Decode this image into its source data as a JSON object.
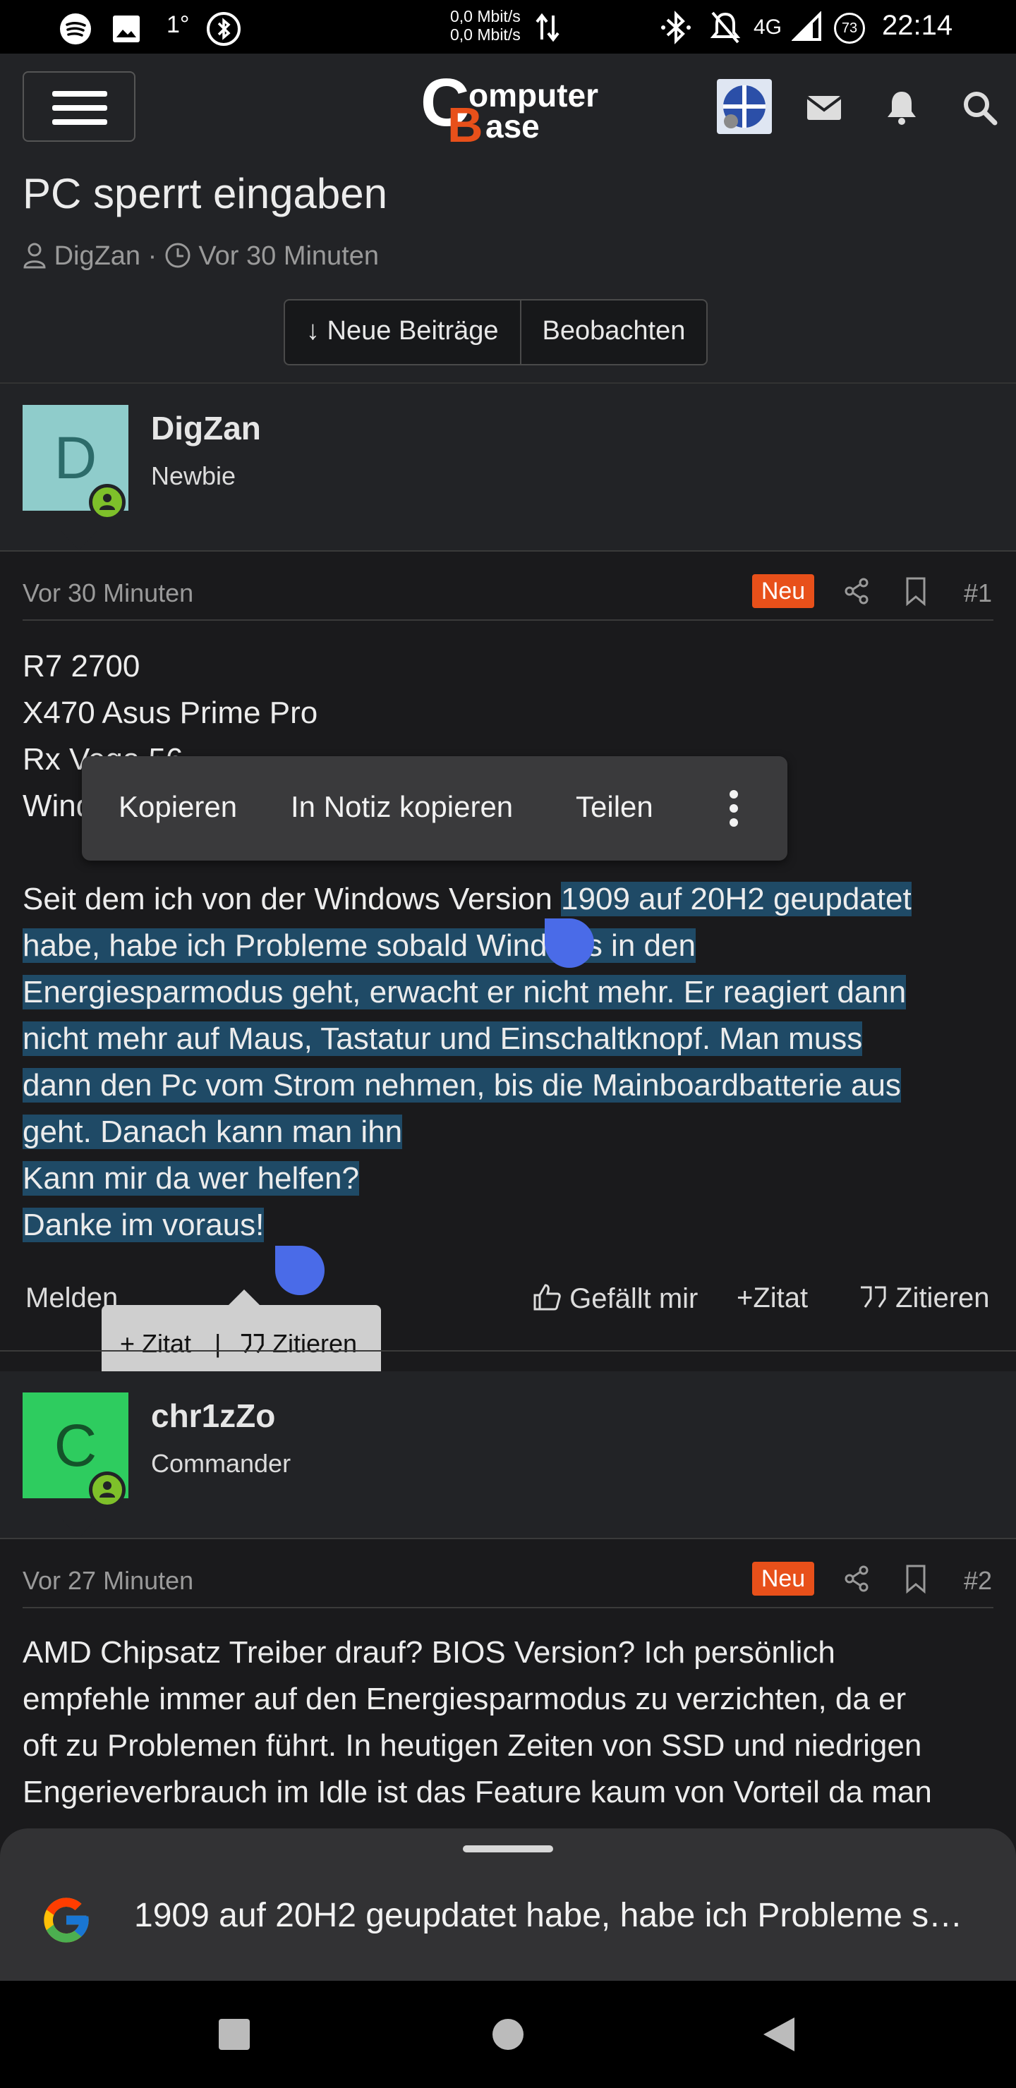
{
  "status_bar": {
    "network_speed_up": "0,0 Mbit/s",
    "network_speed_down": "0,0 Mbit/s",
    "temperature": "1°",
    "network_type": "4G",
    "battery_percent": "73",
    "time": "22:14"
  },
  "header": {
    "logo_letter_c": "C",
    "logo_word_1": "omputer",
    "logo_letter_b": "B",
    "logo_word_2": "ase"
  },
  "thread": {
    "title": "PC sperrt eingaben",
    "author": "DigZan",
    "time": "Vor 30 Minuten",
    "new_posts_button": "↓ Neue Beiträge",
    "watch_button": "Beobachten"
  },
  "post1": {
    "avatar_letter": "D",
    "username": "DigZan",
    "user_title": "Newbie",
    "date": "Vor 30 Minuten",
    "badge": "Neu",
    "number": "#1",
    "lines": [
      "R7 2700",
      "X470 Asus Prime Pro",
      "Rx Vega 56",
      "Wind"
    ],
    "para_unselected": "Seit dem ich von der Windows Version ",
    "para_selected_lines": [
      "1909 auf 20H2 geupdatet",
      "habe, habe ich Probleme sobald Windows in den",
      "Energiesparmodus geht, erwacht er nicht mehr. Er reagiert dann",
      "nicht mehr auf Maus, Tastatur und Einschaltknopf. Man muss",
      "dann den Pc vom Strom nehmen, bis die Mainboardbatterie aus",
      "geht. Danach kann man ihn",
      "Kann mir da wer helfen?",
      "Danke im voraus!"
    ],
    "report": "Melden",
    "like": "Gefällt mir",
    "plus_quote": "Zitat",
    "quote": "Zitieren"
  },
  "context_menu": {
    "copy": "Kopieren",
    "copy_note": "In Notiz kopieren",
    "share": "Teilen"
  },
  "quote_popup": {
    "plus_quote": "Zitat",
    "divider": "|",
    "quote": "Zitieren"
  },
  "post2": {
    "avatar_letter": "C",
    "username": "chr1zZo",
    "user_title": "Commander",
    "date": "Vor 27 Minuten",
    "badge": "Neu",
    "number": "#2",
    "lines": [
      "AMD Chipsatz Treiber drauf? BIOS Version? Ich persönlich",
      "empfehle immer auf den Energiesparmodus zu verzichten, da er",
      "oft zu Problemen führt. In heutigen Zeiten von SSD und niedrigen",
      "Engerieverbrauch im Idle ist das Feature kaum von Vorteil da man"
    ]
  },
  "google_sheet": {
    "logo": "G",
    "text": "1909 auf 20H2 geupdatet habe, habe ich Probleme s…"
  },
  "colors": {
    "accent": "#e8501a",
    "selection": "#1f4a66",
    "selection_handle": "#4a6be8",
    "online": "#7ec02a"
  }
}
